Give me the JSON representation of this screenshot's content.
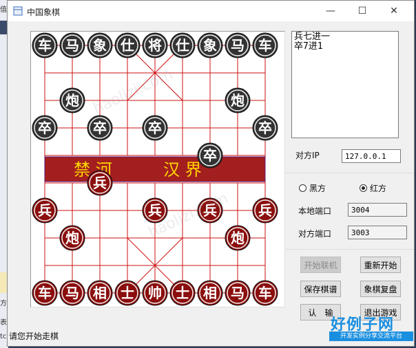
{
  "window": {
    "title": "中国象棋",
    "caption": {
      "minimize": "—",
      "maximize": "☐",
      "close": "✕"
    }
  },
  "background": {
    "left_chars": [
      "值",
      "方",
      "表",
      "tc"
    ]
  },
  "board": {
    "river_left": "禁 河",
    "river_right": "汉 界",
    "pieces": [
      {
        "t": "车",
        "c": "black",
        "col": 0,
        "row": 0
      },
      {
        "t": "马",
        "c": "black",
        "col": 1,
        "row": 0
      },
      {
        "t": "象",
        "c": "black",
        "col": 2,
        "row": 0
      },
      {
        "t": "仕",
        "c": "black",
        "col": 3,
        "row": 0
      },
      {
        "t": "将",
        "c": "black",
        "col": 4,
        "row": 0
      },
      {
        "t": "仕",
        "c": "black",
        "col": 5,
        "row": 0
      },
      {
        "t": "象",
        "c": "black",
        "col": 6,
        "row": 0
      },
      {
        "t": "马",
        "c": "black",
        "col": 7,
        "row": 0
      },
      {
        "t": "车",
        "c": "black",
        "col": 8,
        "row": 0
      },
      {
        "t": "炮",
        "c": "black",
        "col": 1,
        "row": 2
      },
      {
        "t": "炮",
        "c": "black",
        "col": 7,
        "row": 2
      },
      {
        "t": "卒",
        "c": "black",
        "col": 0,
        "row": 3
      },
      {
        "t": "卒",
        "c": "black",
        "col": 2,
        "row": 3
      },
      {
        "t": "卒",
        "c": "black",
        "col": 4,
        "row": 3
      },
      {
        "t": "卒",
        "c": "black",
        "col": 8,
        "row": 3
      },
      {
        "t": "卒",
        "c": "black",
        "col": 6,
        "row": 4
      },
      {
        "t": "兵",
        "c": "red",
        "col": 2,
        "row": 5
      },
      {
        "t": "兵",
        "c": "red",
        "col": 0,
        "row": 6
      },
      {
        "t": "兵",
        "c": "red",
        "col": 4,
        "row": 6
      },
      {
        "t": "兵",
        "c": "red",
        "col": 6,
        "row": 6
      },
      {
        "t": "兵",
        "c": "red",
        "col": 8,
        "row": 6
      },
      {
        "t": "炮",
        "c": "red",
        "col": 1,
        "row": 7
      },
      {
        "t": "炮",
        "c": "red",
        "col": 7,
        "row": 7
      },
      {
        "t": "车",
        "c": "red",
        "col": 0,
        "row": 9
      },
      {
        "t": "马",
        "c": "red",
        "col": 1,
        "row": 9
      },
      {
        "t": "相",
        "c": "red",
        "col": 2,
        "row": 9
      },
      {
        "t": "士",
        "c": "red",
        "col": 3,
        "row": 9
      },
      {
        "t": "帅",
        "c": "red",
        "col": 4,
        "row": 9
      },
      {
        "t": "士",
        "c": "red",
        "col": 5,
        "row": 9
      },
      {
        "t": "相",
        "c": "red",
        "col": 6,
        "row": 9
      },
      {
        "t": "马",
        "c": "red",
        "col": 7,
        "row": 9
      },
      {
        "t": "车",
        "c": "red",
        "col": 8,
        "row": 9
      }
    ]
  },
  "moves": [
    "兵七进一",
    "卒7进1"
  ],
  "opponent_ip": {
    "label": "对方IP",
    "value": "127.0.0.1"
  },
  "side": {
    "black_label": "黑方",
    "red_label": "红方",
    "selected": "red"
  },
  "local_port": {
    "label": "本地端口",
    "value": "3004"
  },
  "remote_port": {
    "label": "对方端口",
    "value": "3003"
  },
  "buttons": {
    "connect": "开始联机",
    "restart": "重新开始",
    "save": "保存棋谱",
    "review": "象棋复盘",
    "resign": "认　输",
    "exit": "退出游戏"
  },
  "status": "请您开始走棋",
  "logo": {
    "title": "好例子网",
    "subtitle": "开发实例分享交流平台"
  },
  "watermark": "haolizi.com",
  "colors": {
    "board_line": "#cc1111",
    "river": "#a31f1f",
    "river_text": "#ffd700",
    "black_piece": "#333333",
    "red_piece": "#8b0d0d"
  }
}
